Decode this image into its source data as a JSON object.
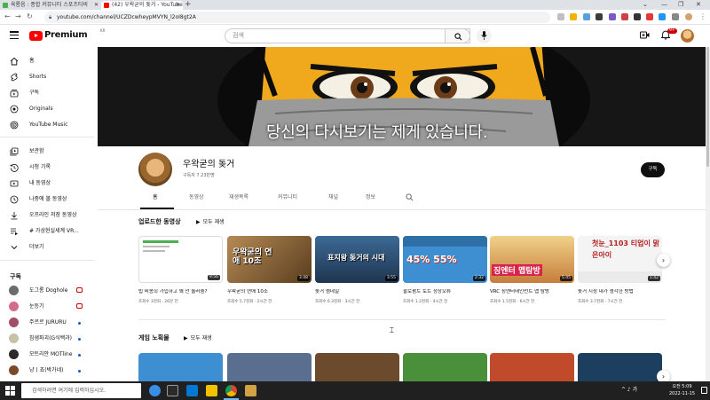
{
  "browser": {
    "tabs": [
      {
        "title": "육룡음 : 종합 커뮤니티 스포츠티비",
        "active": false
      },
      {
        "title": "(42) 우왁굳의 돚거 - YouTube",
        "active": true
      }
    ],
    "url": "youtube.com/channel/UCZDcwheypMVYN_l2oI8gt2A"
  },
  "masthead": {
    "brand": "Premium",
    "country": "KR",
    "search_placeholder": "검색",
    "notification_count": "9+"
  },
  "sidebar": {
    "primary": [
      {
        "label": "홈",
        "icon": "home-icon"
      },
      {
        "label": "Shorts",
        "icon": "shorts-icon"
      },
      {
        "label": "구독",
        "icon": "subscriptions-icon"
      },
      {
        "label": "Originals",
        "icon": "originals-icon"
      },
      {
        "label": "YouTube Music",
        "icon": "music-icon"
      }
    ],
    "library": [
      {
        "label": "보관함",
        "icon": "library-icon"
      },
      {
        "label": "시청 기록",
        "icon": "history-icon"
      },
      {
        "label": "내 동영상",
        "icon": "my-videos-icon"
      },
      {
        "label": "나중에 볼 동영상",
        "icon": "watch-later-icon"
      },
      {
        "label": "오프라인 저장 동영상",
        "icon": "download-icon"
      },
      {
        "label": "# 가상현실세계 VR...",
        "icon": "playlist-icon"
      },
      {
        "label": "더보기",
        "icon": "chevron-down-icon"
      }
    ],
    "subscriptions_heading": "구독",
    "subscriptions": [
      {
        "label": "도그롱 Doghole",
        "status": "live",
        "color": "#6b6b6b"
      },
      {
        "label": "눈등기",
        "status": "new",
        "color": "#d46b8a"
      },
      {
        "label": "주르르 JURURU",
        "status": "new",
        "color": "#a24f6a"
      },
      {
        "label": "침샘파괴(G식백과)",
        "status": "new",
        "color": "#c9c0a8"
      },
      {
        "label": "모트리안 MOTline",
        "status": "new",
        "color": "#2a2a2a"
      },
      {
        "label": "냥 ( 쵸(박가네)",
        "status": "new",
        "color": "#7b4a2a"
      }
    ]
  },
  "channel": {
    "banner_text": "당신의 다시보기는 제게 있습니다.",
    "name": "우왁굳의 돚거",
    "subscribers": "구독자 7.23만명",
    "subscribe_label": "구독",
    "tabs": [
      "홈",
      "동영상",
      "재생목록",
      "커뮤니티",
      "채널",
      "정보"
    ]
  },
  "uploads": {
    "title": "업로드한 동영상",
    "play_all": "모두 재생",
    "videos": [
      {
        "title": "빕 비몽희 가입하고 왜 안 눌러줌?",
        "views": "조회수 3천회",
        "age": "26분 전",
        "duration": "9:56",
        "thumb_text": "",
        "color": "#ffffff"
      },
      {
        "title": "우왁굳의 연애 10조",
        "views": "조회수 5.7천회",
        "age": "2시간 전",
        "duration": "3:48",
        "thumb_text": "우왁굳의 연애 10조",
        "color": "#8a6a43"
      },
      {
        "title": "돚거 썸네일",
        "views": "조회수 6.3천회",
        "age": "3시간 전",
        "duration": "3:55",
        "thumb_text": "표지왕 돚거의 시대",
        "color": "#2d4a6a"
      },
      {
        "title": "팔로팜트 토트 정상오류",
        "views": "조회수 1.2천회",
        "age": "4시간 전",
        "duration": "2:32",
        "thumb_text": "45%  55%",
        "color": "#3d8fd1"
      },
      {
        "title": "VRC 징엔터테인먼트 맵 탐방",
        "views": "조회수 1.5천회",
        "age": "6시간 전",
        "duration": "5:45",
        "thumb_text": "징엔터 맵탐방",
        "color": "#e0b35a"
      },
      {
        "title": "돚거 시청 내가 생각한 방법",
        "views": "조회수 3.7천회",
        "age": "7시간 전",
        "duration": "1:42",
        "thumb_text": "첫눈_1103  티업이 맑은아이",
        "color": "#f4f4f4"
      }
    ]
  },
  "game_shelf": {
    "title": "게임 노획물",
    "play_all": "모두 재생",
    "thumb_colors": [
      "#3d8fd1",
      "#5a6f8f",
      "#6b4b2b",
      "#4a8f3a",
      "#c14a2a",
      "#2a3a4a",
      "#1d3f5f"
    ]
  },
  "taskbar": {
    "search_placeholder": "검색하려면 여기에 입력하십시오.",
    "time": "오전 5:09",
    "date": "2022-11-15",
    "tray_text": "^ ♪ 가"
  }
}
